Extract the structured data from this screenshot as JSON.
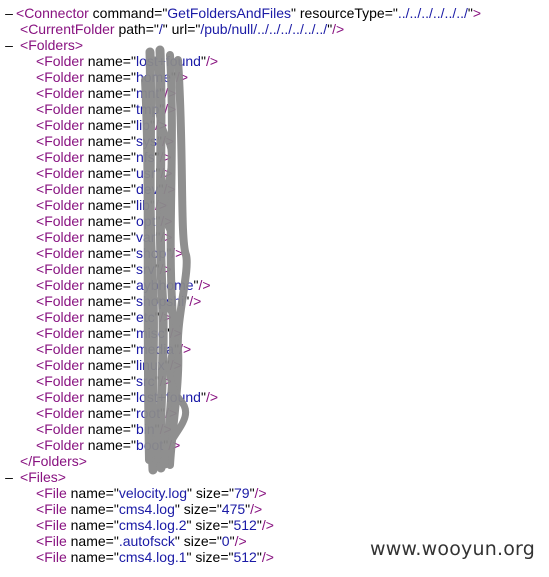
{
  "colors": {
    "tag": "#881280",
    "attribute_name": "#000000",
    "attribute_value": "#1a1aa6",
    "toggle": "#000000",
    "redaction": "#8a8a8a"
  },
  "toggle_glyph": "–",
  "xml": {
    "connector": {
      "tag": "Connector",
      "attrs": [
        {
          "name": "command",
          "value": "GetFoldersAndFiles"
        },
        {
          "name": "resourceType",
          "value": "../../../../../../"
        }
      ]
    },
    "current_folder": {
      "tag": "CurrentFolder",
      "attrs": [
        {
          "name": "path",
          "value": "/"
        },
        {
          "name": "url",
          "value": "/pub/null/../../../../../../"
        }
      ]
    },
    "folders_open": "Folders",
    "folder_tag": "Folder",
    "folder_attr": "name",
    "folders": [
      "lost+found",
      "home",
      "mnt",
      "tmp",
      "lib",
      "sys",
      "nfs",
      "usr",
      "dev",
      "lib",
      "opt",
      "var",
      "shop",
      "srv",
      "aybhome",
      "shopshi",
      "etc",
      "misc",
      "media",
      "linux",
      "src",
      "lost+found",
      "root",
      "bin",
      "boot"
    ],
    "folders_close": "/Folders",
    "files_open": "Files",
    "file_tag": "File",
    "files": [
      {
        "name": "velocity.log",
        "size": "79"
      },
      {
        "name": "cms4.log",
        "size": "475"
      },
      {
        "name": "cms4.log.2",
        "size": "512"
      },
      {
        "name": ".autofsck",
        "size": "0"
      },
      {
        "name": "cms4.log.1",
        "size": "512"
      }
    ]
  },
  "watermark": "www.wooyun.org"
}
